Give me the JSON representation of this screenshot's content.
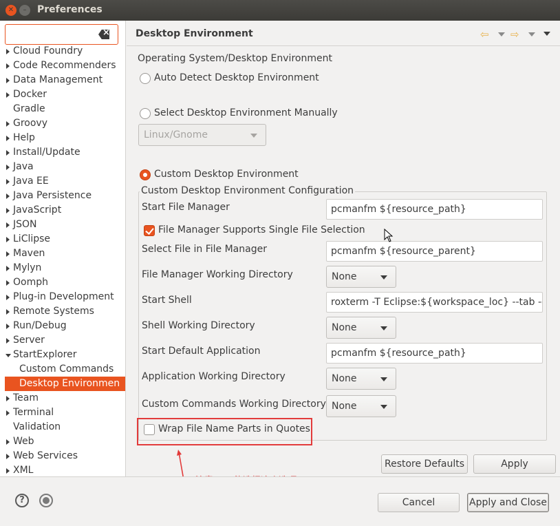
{
  "window": {
    "title": "Preferences"
  },
  "filter": {
    "value": "",
    "placeholder": ""
  },
  "tree": [
    {
      "label": "Cloud Foundry",
      "arrow": "right"
    },
    {
      "label": "Code Recommenders",
      "arrow": "right"
    },
    {
      "label": "Data Management",
      "arrow": "right"
    },
    {
      "label": "Docker",
      "arrow": "right"
    },
    {
      "label": "Gradle",
      "arrow": "none"
    },
    {
      "label": "Groovy",
      "arrow": "right"
    },
    {
      "label": "Help",
      "arrow": "right"
    },
    {
      "label": "Install/Update",
      "arrow": "right"
    },
    {
      "label": "Java",
      "arrow": "right"
    },
    {
      "label": "Java EE",
      "arrow": "right"
    },
    {
      "label": "Java Persistence",
      "arrow": "right"
    },
    {
      "label": "JavaScript",
      "arrow": "right"
    },
    {
      "label": "JSON",
      "arrow": "right"
    },
    {
      "label": "LiClipse",
      "arrow": "right"
    },
    {
      "label": "Maven",
      "arrow": "right"
    },
    {
      "label": "Mylyn",
      "arrow": "right"
    },
    {
      "label": "Oomph",
      "arrow": "right"
    },
    {
      "label": "Plug-in Development",
      "arrow": "right"
    },
    {
      "label": "Remote Systems",
      "arrow": "right"
    },
    {
      "label": "Run/Debug",
      "arrow": "right"
    },
    {
      "label": "Server",
      "arrow": "right"
    },
    {
      "label": "StartExplorer",
      "arrow": "down"
    },
    {
      "label": "Custom Commands",
      "arrow": "child"
    },
    {
      "label": "Desktop Environmen",
      "arrow": "child-selected"
    },
    {
      "label": "Team",
      "arrow": "right"
    },
    {
      "label": "Terminal",
      "arrow": "right"
    },
    {
      "label": "Validation",
      "arrow": "none"
    },
    {
      "label": "Web",
      "arrow": "right"
    },
    {
      "label": "Web Services",
      "arrow": "right"
    },
    {
      "label": "XML",
      "arrow": "right"
    }
  ],
  "page": {
    "title": "Desktop Environment",
    "section_title": "Operating System/Desktop Environment",
    "radio_auto": "Auto Detect Desktop Environment",
    "radio_manual": "Select Desktop Environment Manually",
    "manual_combo": "Linux/Gnome",
    "radio_custom": "Custom Desktop Environment",
    "group_title": "Custom Desktop Environment Configuration",
    "start_file_manager_label": "Start File Manager",
    "start_file_manager_value": "pcmanfm ${resource_path}",
    "single_file_selection_label": "File Manager Supports Single File Selection",
    "select_file_label": "Select File in File Manager",
    "select_file_value": "pcmanfm ${resource_parent}",
    "fm_workdir_label": "File Manager Working Directory",
    "fm_workdir_value": "None",
    "start_shell_label": "Start Shell",
    "start_shell_value": "roxterm -T Eclipse:${workspace_loc} --tab -d ${",
    "shell_workdir_label": "Shell Working Directory",
    "shell_workdir_value": "None",
    "start_default_app_label": "Start Default Application",
    "start_default_app_value": "pcmanfm ${resource_path}",
    "app_workdir_label": "Application Working Directory",
    "app_workdir_value": "None",
    "cc_workdir_label": "Custom Commands Working Directory",
    "cc_workdir_value": "None",
    "wrap_quotes_label": "Wrap File Name Parts in Quotes",
    "note": "注意： 不能选择这个选项"
  },
  "buttons": {
    "restore_defaults": "Restore Defaults",
    "apply": "Apply",
    "cancel": "Cancel",
    "apply_and_close": "Apply and Close"
  },
  "colors": {
    "accent": "#e95420",
    "annotation": "#e23b3b"
  }
}
